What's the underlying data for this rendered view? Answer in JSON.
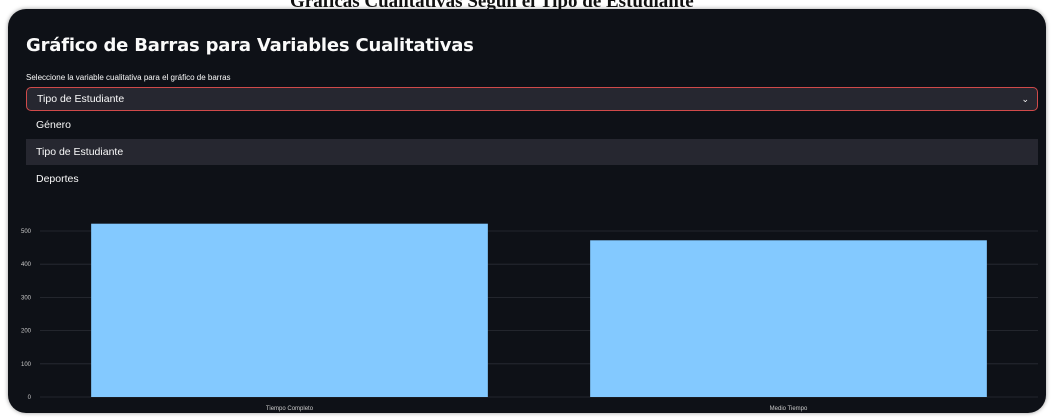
{
  "caption": "Gráficas Cualitativas Según el Tipo de Estudiante",
  "app": {
    "title": "Gráfico de Barras para Variables Cualitativas",
    "select_label": "Seleccione la variable cualitativa para el gráfico de barras",
    "selected_value": "Tipo de Estudiante",
    "options": [
      "Género",
      "Tipo de Estudiante",
      "Deportes"
    ],
    "highlighted_option_index": 1,
    "chevron_icon": "chevron-down-icon",
    "colors": {
      "background": "#0e1117",
      "select_bg": "#262730",
      "select_border": "#d04a4a",
      "bar": "#83c9ff"
    }
  },
  "chart_data": {
    "type": "bar",
    "categories": [
      "Tiempo Completo",
      "Medio Tiempo"
    ],
    "values": [
      522,
      472
    ],
    "ylim": [
      0,
      500
    ],
    "yticks": [
      0,
      100,
      200,
      300,
      400,
      500
    ],
    "title": "",
    "xlabel": "",
    "ylabel": "",
    "grid": true
  }
}
